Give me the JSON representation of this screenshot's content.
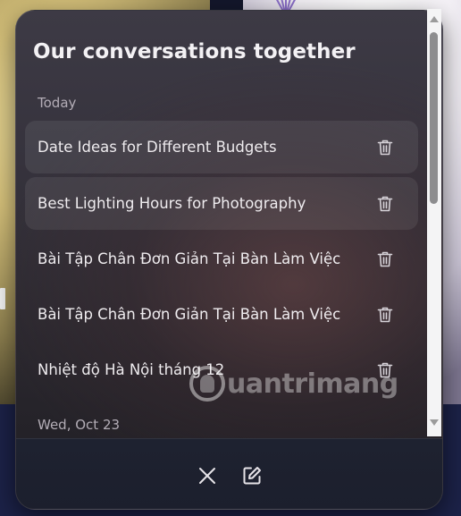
{
  "panel": {
    "title": "Our conversations together"
  },
  "sections": [
    {
      "label": "Today",
      "items": [
        {
          "title": "Date Ideas for Different Budgets",
          "active": true
        },
        {
          "title": "Best Lighting Hours for Photography",
          "active": true
        },
        {
          "title": "Bài Tập Chân Đơn Giản Tại Bàn Làm Việc",
          "active": false
        },
        {
          "title": "Bài Tập Chân Đơn Giản Tại Bàn Làm Việc",
          "active": false
        },
        {
          "title": "Nhiệt độ Hà Nội tháng 12",
          "active": false
        }
      ]
    },
    {
      "label": "Wed, Oct 23",
      "items": []
    }
  ],
  "item_icon": "trash-icon",
  "footer": {
    "close_icon": "close-icon",
    "new_chat_icon": "new-chat-icon"
  },
  "watermark": {
    "text": "uantrimang"
  },
  "colors": {
    "text_primary": "#efecef",
    "text_secondary": "#b3adb6",
    "panel_bg": "#36333d",
    "footer_bg": "#1e2230"
  }
}
